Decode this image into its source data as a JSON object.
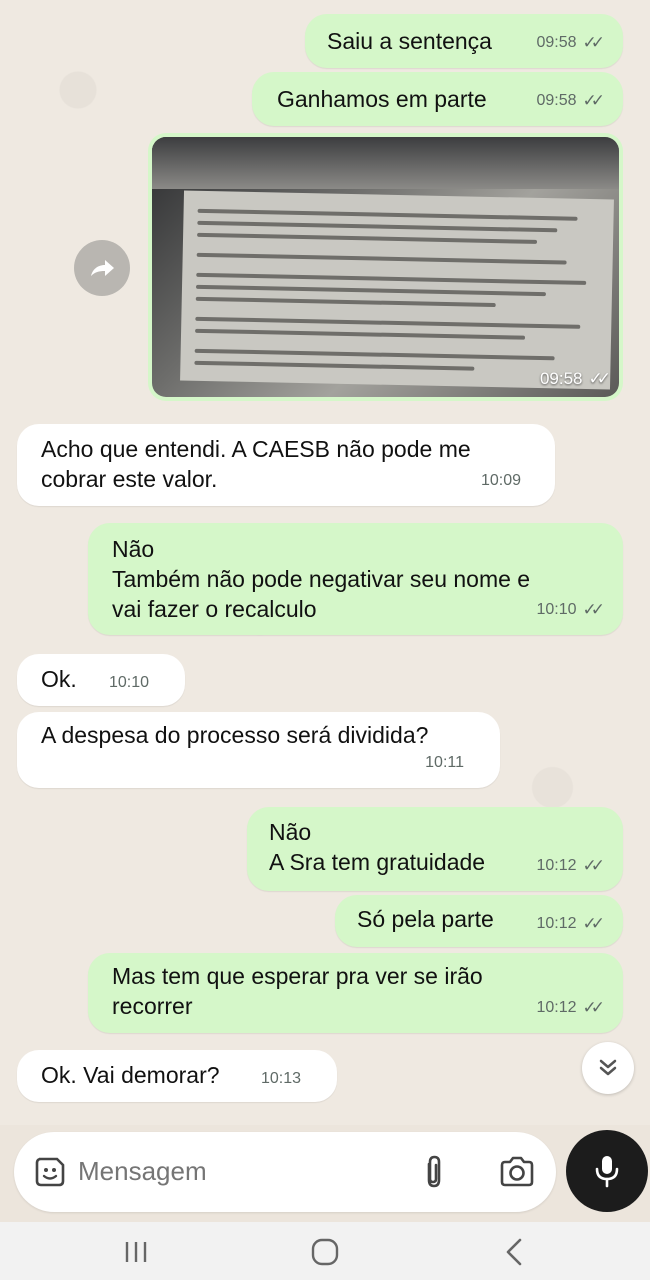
{
  "chat": {
    "messages": [
      {
        "id": "m1",
        "direction": "outgoing",
        "text": "Saiu a sentença",
        "time": "09:58",
        "status": "read"
      },
      {
        "id": "m2",
        "direction": "outgoing",
        "text": "Ganhamos em parte",
        "time": "09:58",
        "status": "read"
      },
      {
        "id": "m3",
        "direction": "outgoing",
        "type": "image",
        "time": "09:58",
        "status": "read"
      },
      {
        "id": "m4",
        "direction": "incoming",
        "text": "Acho que entendi. A CAESB não pode me\ncobrar este valor.",
        "time": "10:09"
      },
      {
        "id": "m5",
        "direction": "outgoing",
        "text": "Não\nTambém não pode negativar seu nome e\nvai fazer o recalculo",
        "time": "10:10",
        "status": "read"
      },
      {
        "id": "m6",
        "direction": "incoming",
        "text": "Ok.",
        "time": "10:10"
      },
      {
        "id": "m7",
        "direction": "incoming",
        "text": "A despesa do processo será dividida?",
        "time": "10:11"
      },
      {
        "id": "m8",
        "direction": "outgoing",
        "text": "Não\nA Sra tem gratuidade",
        "time": "10:12",
        "status": "read"
      },
      {
        "id": "m9",
        "direction": "outgoing",
        "text": "Só pela parte",
        "time": "10:12",
        "status": "read"
      },
      {
        "id": "m10",
        "direction": "outgoing",
        "text": "Mas tem que esperar pra ver se irão\nrecorrer",
        "time": "10:12",
        "status": "read"
      },
      {
        "id": "m11",
        "direction": "incoming",
        "text": "Ok. Vai demorar?",
        "time": "10:13"
      }
    ]
  },
  "composer": {
    "placeholder": "Mensagem",
    "icons": {
      "emoji": "sticker-emoji-icon",
      "attach": "paperclip-icon",
      "camera": "camera-icon",
      "mic": "microphone-icon"
    }
  },
  "icons": {
    "forward": "forward-icon",
    "scroll_down": "double-chevron-down-icon",
    "read_receipt": "double-check-icon"
  },
  "navbar": {
    "icons": [
      "recent-apps-icon",
      "home-icon",
      "back-icon"
    ]
  },
  "colors": {
    "outgoing_bubble": "#d5f7c9",
    "incoming_bubble": "#ffffff",
    "chat_background": "#efe9e1",
    "mic_button": "#1c1c1c"
  }
}
